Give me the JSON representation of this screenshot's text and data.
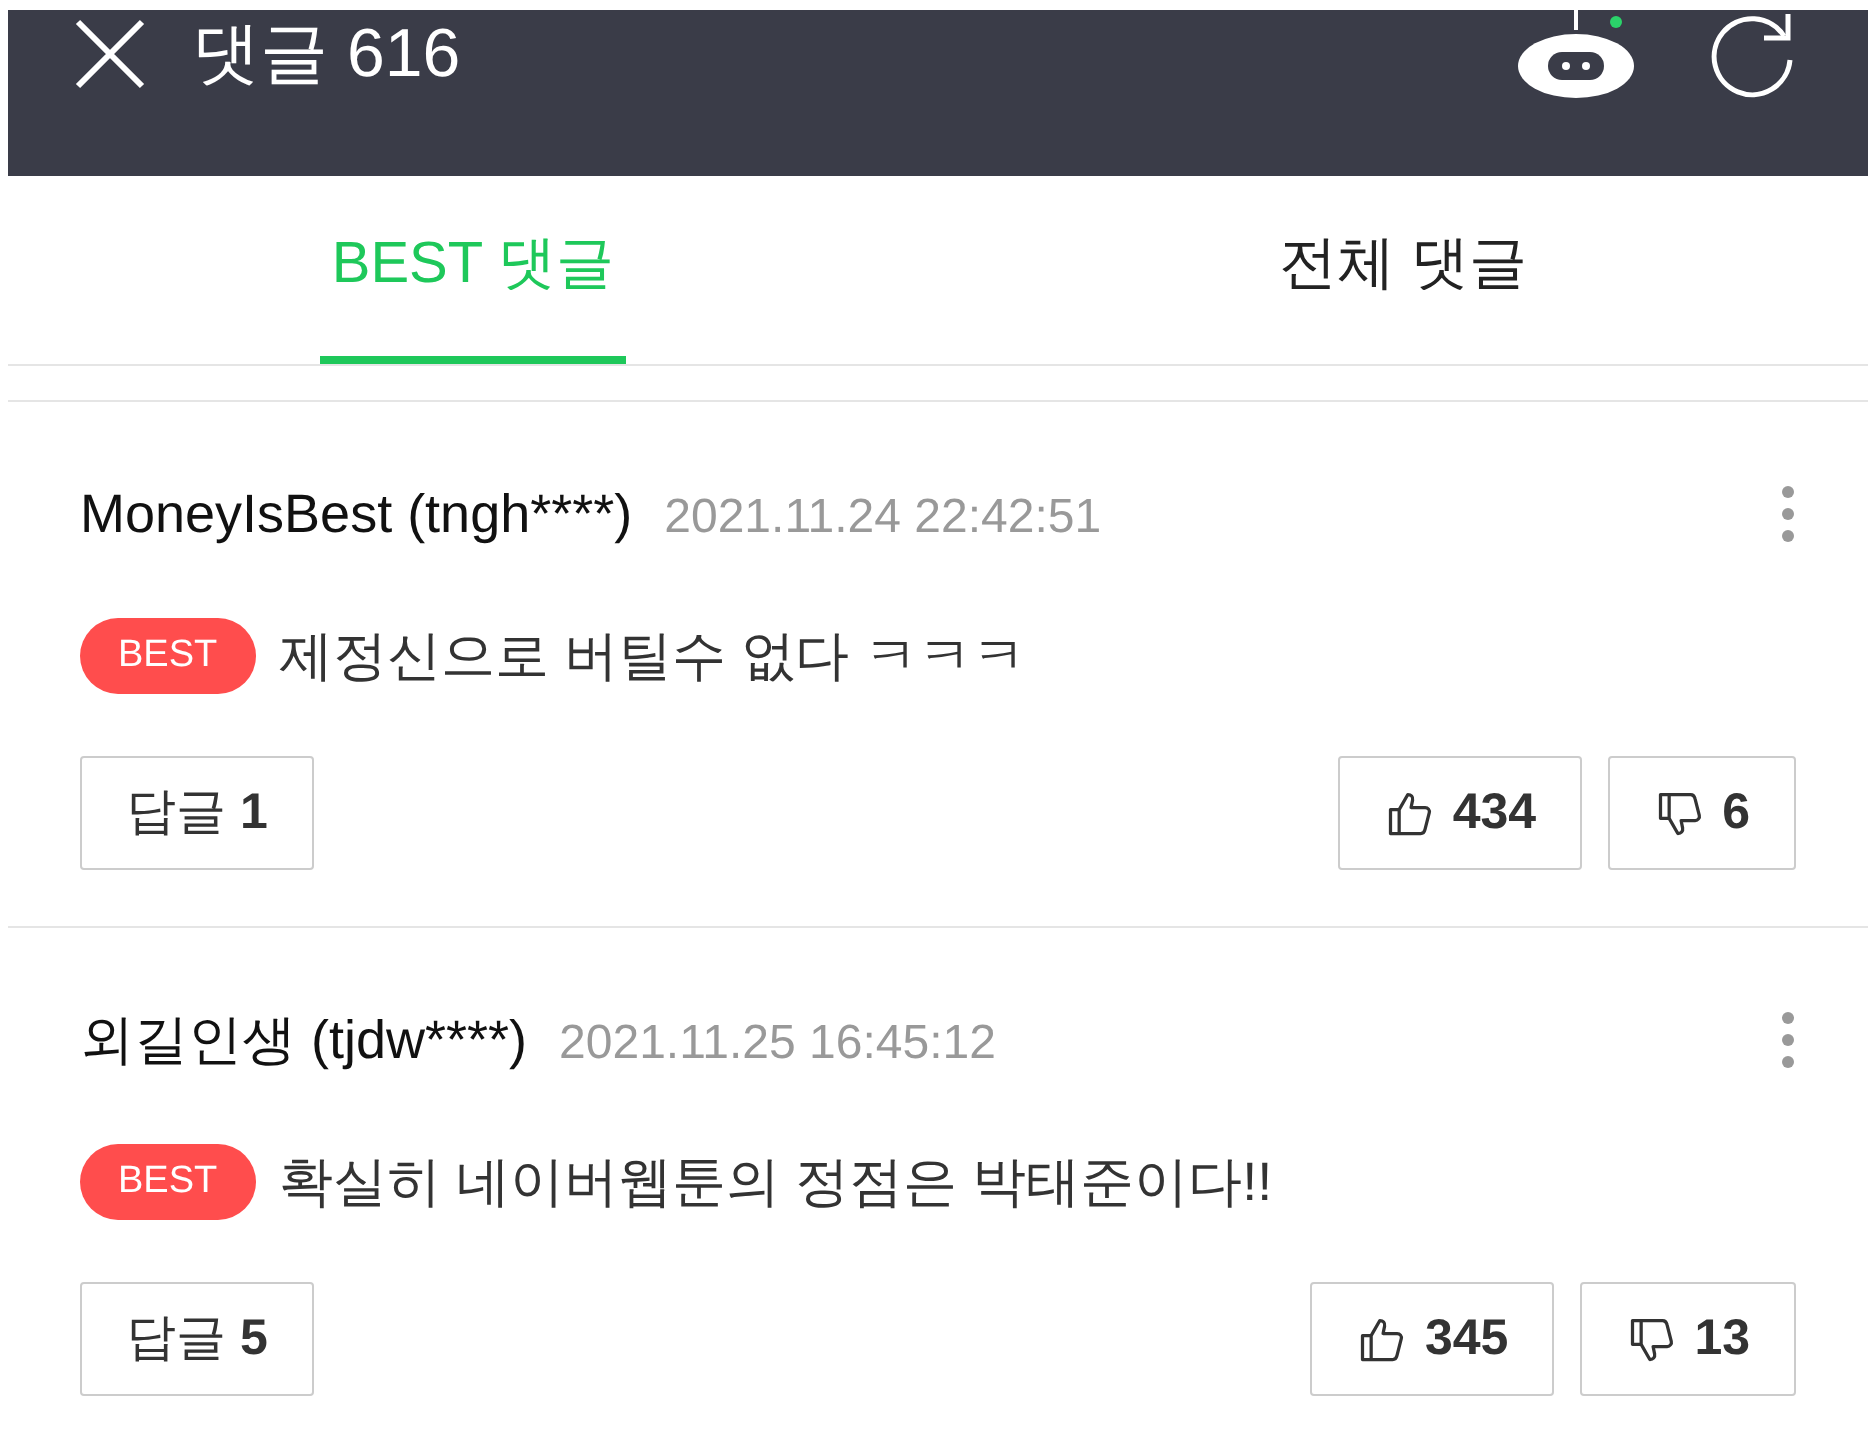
{
  "header": {
    "title": "댓글 616"
  },
  "tabs": [
    {
      "label": "BEST 댓글",
      "selected": true
    },
    {
      "label": "전체 댓글",
      "selected": false
    }
  ],
  "comments": [
    {
      "author": "MoneyIsBest (tngh****)",
      "date": "2021.11.24 22:42:51",
      "badge": "BEST",
      "text": "제정신으로 버틸수 없다 ㅋㅋㅋ",
      "reply": {
        "label": "답글",
        "count": "1"
      },
      "likes": "434",
      "dislikes": "6"
    },
    {
      "author": "외길인생 (tjdw****)",
      "date": "2021.11.25 16:45:12",
      "badge": "BEST",
      "text": "확실히 네이버웹툰의 정점은 박태준이다!!",
      "reply": {
        "label": "답글",
        "count": "5"
      },
      "likes": "345",
      "dislikes": "13"
    }
  ]
}
